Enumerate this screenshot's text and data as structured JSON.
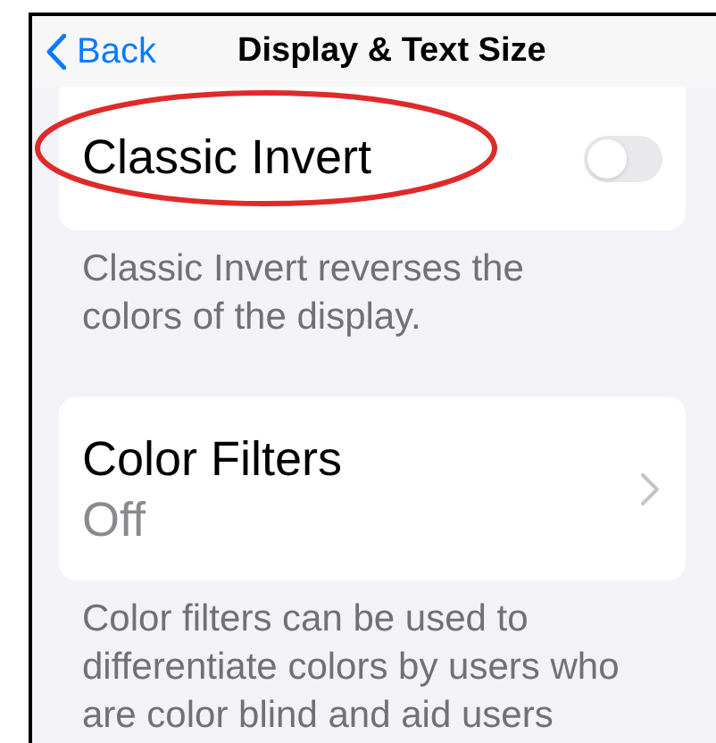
{
  "nav": {
    "back_label": "Back",
    "title": "Display & Text Size"
  },
  "sections": [
    {
      "rows": [
        {
          "kind": "toggle",
          "label": "Classic Invert",
          "on": false
        }
      ],
      "footer": "Classic Invert reverses the colors of the display."
    },
    {
      "rows": [
        {
          "kind": "link",
          "label": "Color Filters",
          "value": "Off"
        }
      ],
      "footer": "Color filters can be used to differentiate colors by users who are color blind and aid users"
    }
  ]
}
